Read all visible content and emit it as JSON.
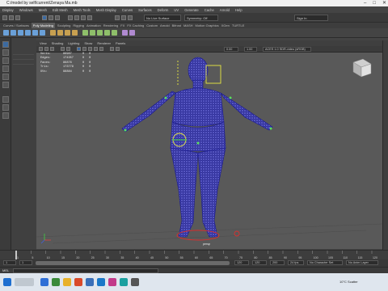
{
  "window": {
    "title": "C:/model by self/current/Zenaya Ma.mb"
  },
  "menus": [
    "Display",
    "Windows",
    "Mesh",
    "Edit Mesh",
    "Mesh Tools",
    "Mesh Display",
    "Curves",
    "Surfaces",
    "Deform",
    "UV",
    "Generate",
    "Cache",
    "Arnold",
    "Help"
  ],
  "status_line": {
    "no_live_surface": "No Live Surface",
    "symmetry": "Symmetry: Off",
    "sign_in": "Sign In"
  },
  "shelf_tabs": [
    {
      "label": "Curves / Surfaces",
      "active": false
    },
    {
      "label": "Poly Modeling",
      "active": true
    },
    {
      "label": "Sculpting",
      "active": false
    },
    {
      "label": "Rigging",
      "active": false
    },
    {
      "label": "Animation",
      "active": false
    },
    {
      "label": "Rendering",
      "active": false
    },
    {
      "label": "FX",
      "active": false
    },
    {
      "label": "FX Caching",
      "active": false
    },
    {
      "label": "Custom",
      "active": false
    },
    {
      "label": "Arnold",
      "active": false
    },
    {
      "label": "Bifrost",
      "active": false
    },
    {
      "label": "MASH",
      "active": false
    },
    {
      "label": "Motion Graphics",
      "active": false
    },
    {
      "label": "XGen",
      "active": false
    },
    {
      "label": "TURTLE",
      "active": false
    }
  ],
  "viewport_menu": [
    "View",
    "Shading",
    "Lighting",
    "Show",
    "Renderer",
    "Panels"
  ],
  "viewport_toolbar": {
    "value1": "0.00",
    "value2": "1.00",
    "colorspace": "ACES 1.0 SDR-video (sRGB)"
  },
  "hud": {
    "rows": [
      {
        "label": "Verts:",
        "a": "86987",
        "b": "0",
        "c": "0"
      },
      {
        "label": "Edges:",
        "a": "174357",
        "b": "0",
        "c": "0"
      },
      {
        "label": "Faces:",
        "a": "86876",
        "b": "0",
        "c": "0"
      },
      {
        "label": "Tris:",
        "a": "173779",
        "b": "0",
        "c": "0"
      },
      {
        "label": "UVs:",
        "a": "96884",
        "b": "0",
        "c": "0"
      }
    ]
  },
  "viewport": {
    "camera_label": "persp"
  },
  "timeline": {
    "ticks": [
      "1",
      "5",
      "10",
      "15",
      "20",
      "25",
      "30",
      "35",
      "40",
      "45",
      "50",
      "55",
      "60",
      "65",
      "70",
      "75",
      "80",
      "85",
      "90",
      "95",
      "100",
      "105",
      "110",
      "115",
      "120"
    ],
    "current": "1"
  },
  "range": {
    "start": "1",
    "inner_start": "1",
    "inner_end": "120",
    "end": "120",
    "outer_end": "200",
    "fps": "24 fps",
    "character_set": "No Character Set",
    "anim_layer": "No Anim Layer"
  },
  "cmdline": {
    "label": "MEL"
  },
  "taskbar": {
    "weather": "10°C  Scatter",
    "time": "",
    "colors": [
      "#2f6fd6",
      "#3a8a3a",
      "#e8b12a",
      "#d94a2a",
      "#3a6fb8",
      "#1a78c8",
      "#c23a8a",
      "#1aa0a0",
      "#555555"
    ]
  }
}
